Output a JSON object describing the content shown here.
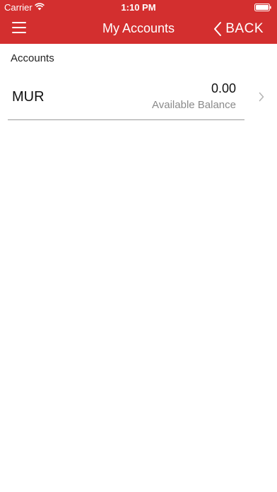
{
  "status_bar": {
    "carrier": "Carrier",
    "time": "1:10 PM",
    "wifi_icon": "wifi-icon",
    "battery_icon": "battery-full-icon"
  },
  "nav": {
    "title": "My Accounts",
    "back_label": "BACK",
    "menu_icon": "hamburger-menu-icon",
    "back_icon": "chevron-left-icon"
  },
  "section": {
    "title": "Accounts"
  },
  "accounts": [
    {
      "currency": "MUR",
      "amount": "0.00",
      "balance_label": "Available Balance"
    }
  ],
  "colors": {
    "brand": "#d32f2f",
    "text_primary": "#111111",
    "text_secondary": "#8a8a8a",
    "divider": "#9a9a9a"
  }
}
